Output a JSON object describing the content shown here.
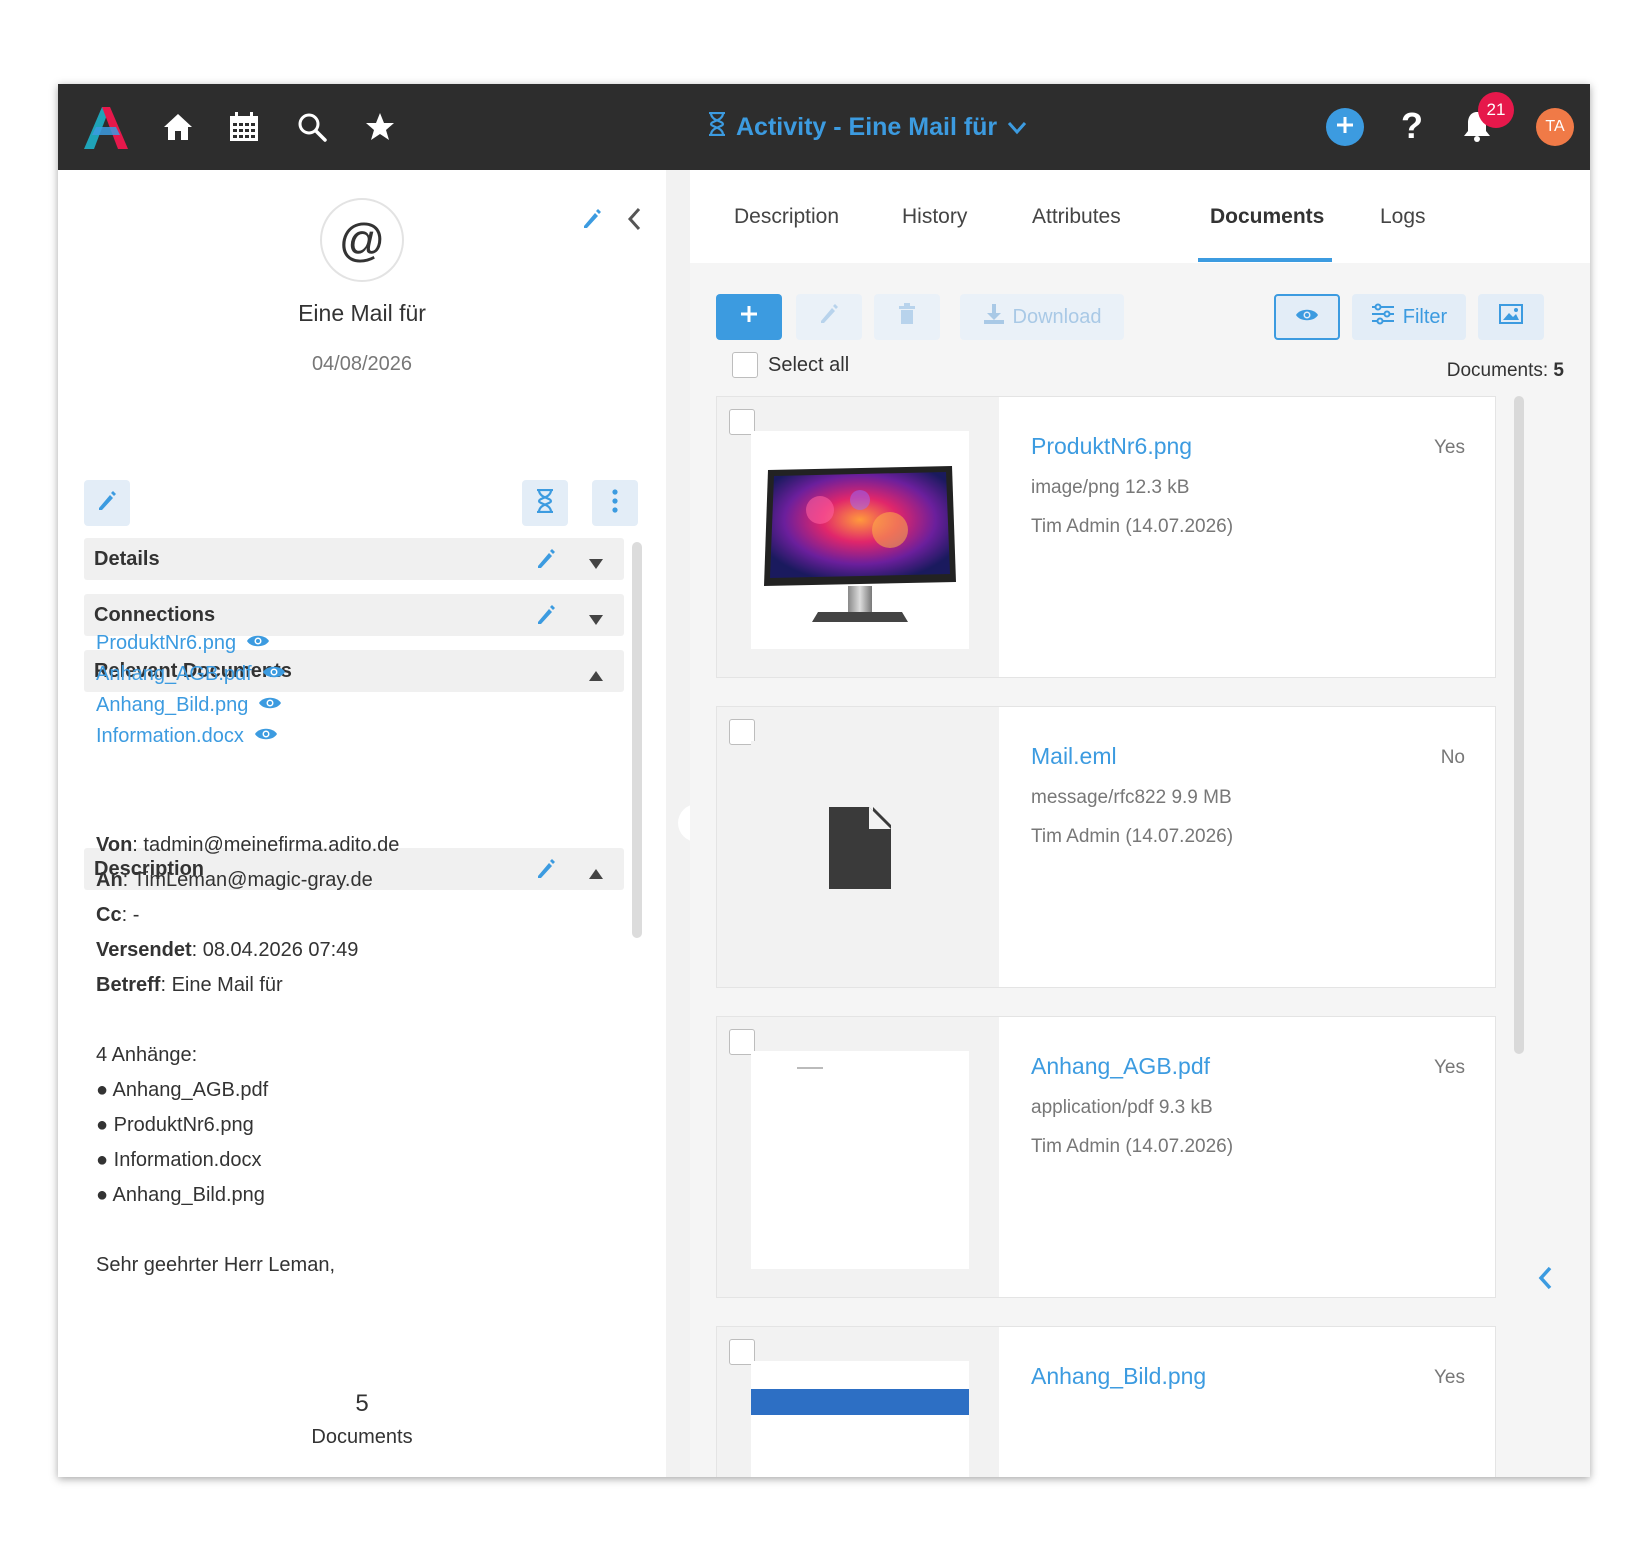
{
  "header": {
    "title": "Activity - Eine Mail für",
    "notification_count": "21",
    "help_label": "?",
    "avatar_initials": "TA"
  },
  "colors": {
    "accent": "#3c9be0",
    "topbar": "#2d2d2d",
    "badge": "#e6184b",
    "avatar": "#f07a47"
  },
  "record": {
    "icon_glyph": "@",
    "subject": "Eine Mail für",
    "date": "04/08/2026"
  },
  "sections": {
    "details": "Details",
    "connections": "Connections",
    "relevant_documents": "Relevant Documents",
    "description": "Description"
  },
  "relevant_documents": [
    "ProduktNr6.png",
    "Anhang_AGB.pdf",
    "Anhang_Bild.png",
    "Information.docx"
  ],
  "description_lines": [
    {
      "label": "Von",
      "value": ": tadmin@meinefirma.adito.de"
    },
    {
      "label": "An",
      "value": ": TimLeman@magic-gray.de"
    },
    {
      "label": "Cc",
      "value": ": -"
    },
    {
      "label": "Versendet",
      "value": ": 08.04.2026 07:49"
    },
    {
      "label": "Betreff",
      "value": ": Eine Mail für"
    },
    {
      "label": "",
      "value": ""
    },
    {
      "label": "",
      "value": "4 Anhänge:"
    },
    {
      "label": "",
      "value": "● Anhang_AGB.pdf"
    },
    {
      "label": "",
      "value": "● ProduktNr6.png"
    },
    {
      "label": "",
      "value": "● Information.docx"
    },
    {
      "label": "",
      "value": "● Anhang_Bild.png"
    },
    {
      "label": "",
      "value": ""
    },
    {
      "label": "",
      "value": "Sehr geehrter Herr Leman,"
    }
  ],
  "summary": {
    "count": "5",
    "label": "Documents"
  },
  "tabs": [
    "Description",
    "History",
    "Attributes",
    "Documents",
    "Logs"
  ],
  "active_tab": "Documents",
  "toolbar": {
    "download_label": "Download",
    "filter_label": "Filter",
    "select_all_label": "Select all",
    "documents_count_label": "Documents: ",
    "documents_count": "5"
  },
  "documents": [
    {
      "name": "ProduktNr6.png",
      "meta": "image/png 12.3 kB",
      "author": "Tim Admin (14.07.2026)",
      "flag": "Yes",
      "thumb": "monitor"
    },
    {
      "name": "Mail.eml",
      "meta": "message/rfc822 9.9 MB",
      "author": "Tim Admin (14.07.2026)",
      "flag": "No",
      "thumb": "file"
    },
    {
      "name": "Anhang_AGB.pdf",
      "meta": "application/pdf 9.3 kB",
      "author": "Tim Admin (14.07.2026)",
      "flag": "Yes",
      "thumb": "pdf"
    },
    {
      "name": "Anhang_Bild.png",
      "meta": "",
      "author": "",
      "flag": "Yes",
      "thumb": "image"
    }
  ],
  "icons": {
    "logo": "adito-logo-icon",
    "home": "home-icon",
    "calendar": "calendar-icon",
    "search": "search-icon",
    "favorites": "star-icon",
    "activity": "hourglass-icon",
    "add": "plus-icon",
    "notifications": "bell-icon",
    "edit": "pencil-icon",
    "delete": "trash-icon",
    "preview": "eye-icon",
    "filter": "sliders-icon",
    "image": "image-icon"
  }
}
